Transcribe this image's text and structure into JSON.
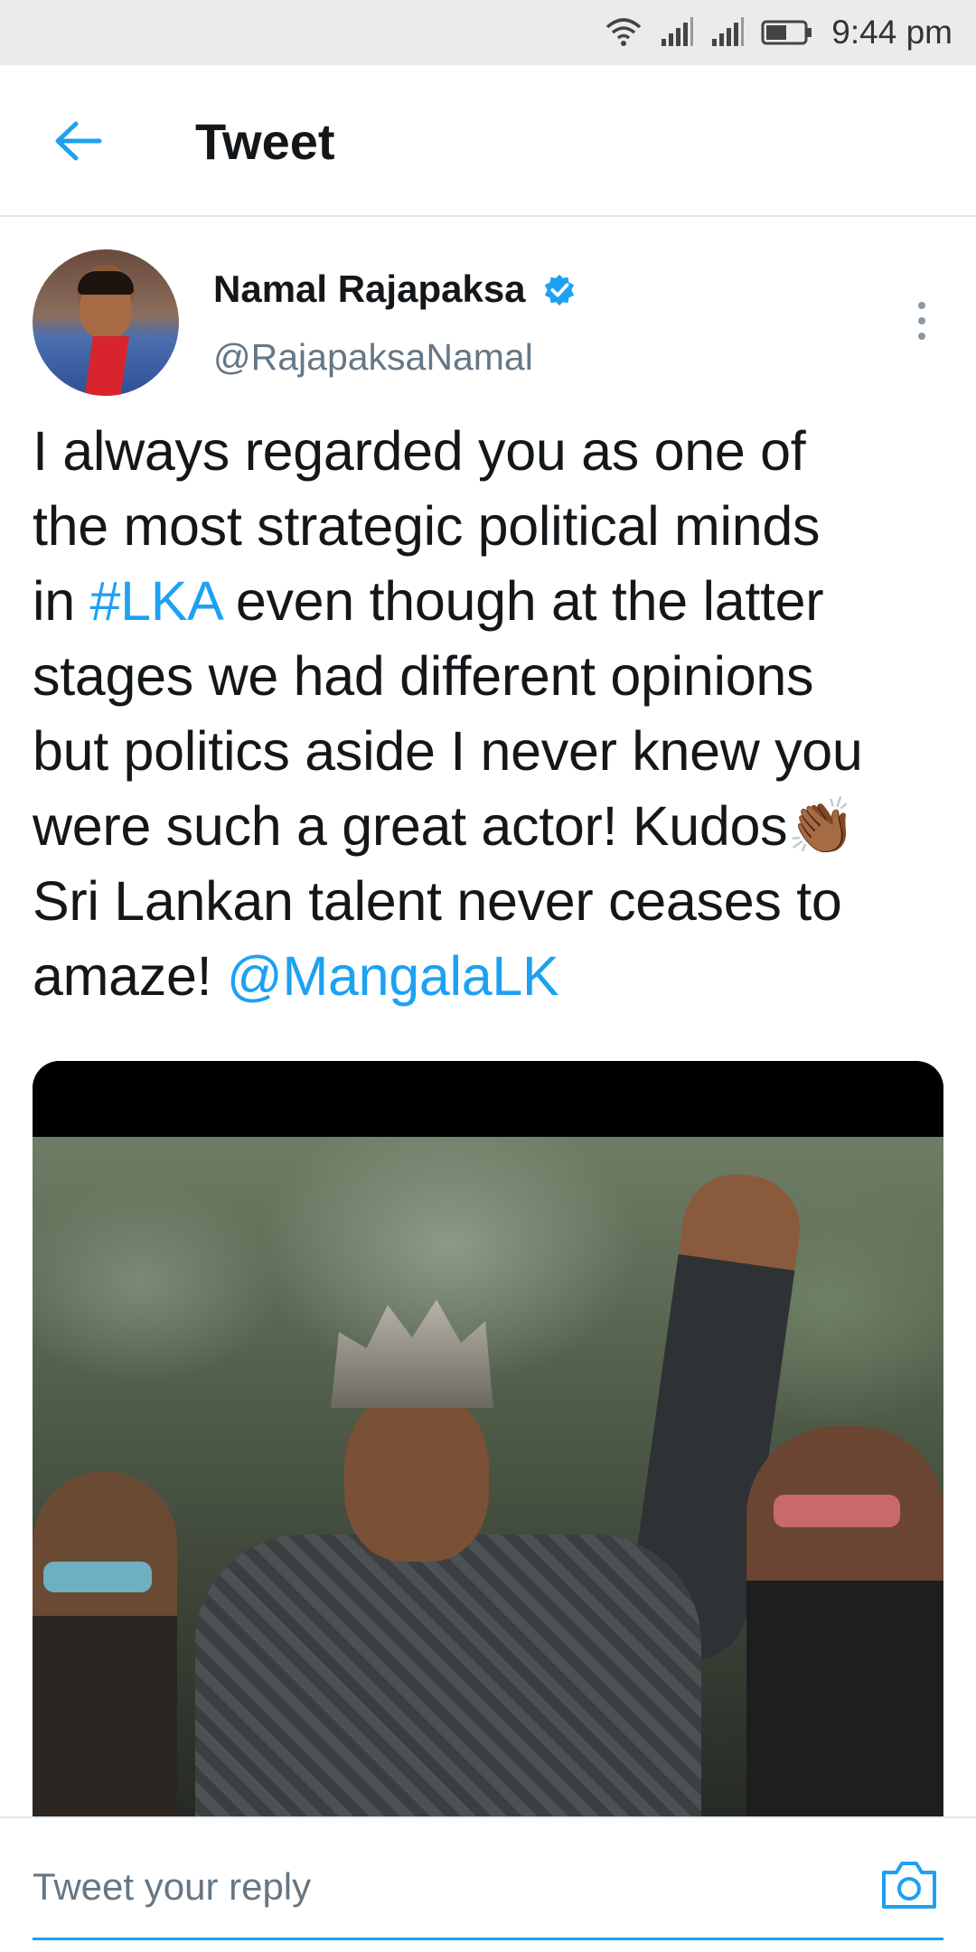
{
  "status_bar": {
    "time": "9:44 pm",
    "icons": [
      "wifi-icon",
      "signal-icon",
      "signal-icon",
      "battery-icon"
    ]
  },
  "app_bar": {
    "back_icon": "arrow-left-icon",
    "title": "Tweet"
  },
  "tweet": {
    "author": {
      "name": "Namal Rajapaksa",
      "handle": "@RajapaksaNamal",
      "verified": true
    },
    "more_icon": "more-vertical-icon",
    "text_lines": [
      {
        "parts": [
          {
            "t": "I always regarded you as one of"
          }
        ]
      },
      {
        "parts": [
          {
            "t": "the most strategic political minds"
          }
        ]
      },
      {
        "parts": [
          {
            "t": "in "
          },
          {
            "t": "#LKA",
            "link": true
          },
          {
            "t": " even though at the latter"
          }
        ]
      },
      {
        "parts": [
          {
            "t": "stages we had different opinions"
          }
        ]
      },
      {
        "parts": [
          {
            "t": "but politics aside I never knew you"
          }
        ]
      },
      {
        "parts": [
          {
            "t": "were such a great actor! Kudos"
          },
          {
            "t": "👏🏾",
            "emoji": true
          }
        ]
      },
      {
        "parts": [
          {
            "t": "Sri Lankan talent never ceases to"
          }
        ]
      },
      {
        "parts": [
          {
            "t": "amaze! "
          },
          {
            "t": "@MangalaLK",
            "link": true
          }
        ]
      }
    ]
  },
  "reply": {
    "placeholder": "Tweet your reply",
    "camera_icon": "camera-icon"
  },
  "colors": {
    "accent": "#1da1f2",
    "text": "#14171a",
    "secondary": "#657786",
    "status_bar_bg": "#ebebeb"
  }
}
